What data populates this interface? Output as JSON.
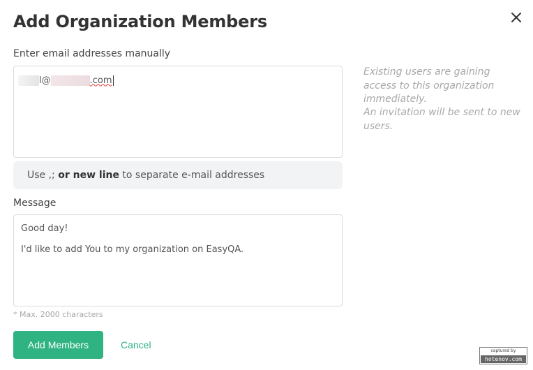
{
  "dialog": {
    "title": "Add Organization Members",
    "close_icon": "close-icon"
  },
  "emails": {
    "label": "Enter email addresses manually",
    "value_visible_parts": [
      "l@",
      ".com"
    ],
    "hint_prefix": "Use ,; ",
    "hint_bold": "or new line",
    "hint_suffix": " to separate e-mail addresses"
  },
  "side_notes": [
    "Existing users are gaining access to this organization immediately.",
    "An invitation will be sent to new users."
  ],
  "message": {
    "label": "Message",
    "line1": "Good day!",
    "line2": "I'd like to add You to my organization on EasyQA.",
    "limit_note": "* Max. 2000 characters"
  },
  "actions": {
    "add_label": "Add Members",
    "cancel_label": "Cancel"
  },
  "watermark": {
    "top": "captured by",
    "bottom": "hotenov.com"
  },
  "colors": {
    "accent": "#2fb383",
    "hint_bg": "#f2f3f4",
    "muted_text": "#a8a8a8",
    "spellcheck": "#e53935"
  }
}
